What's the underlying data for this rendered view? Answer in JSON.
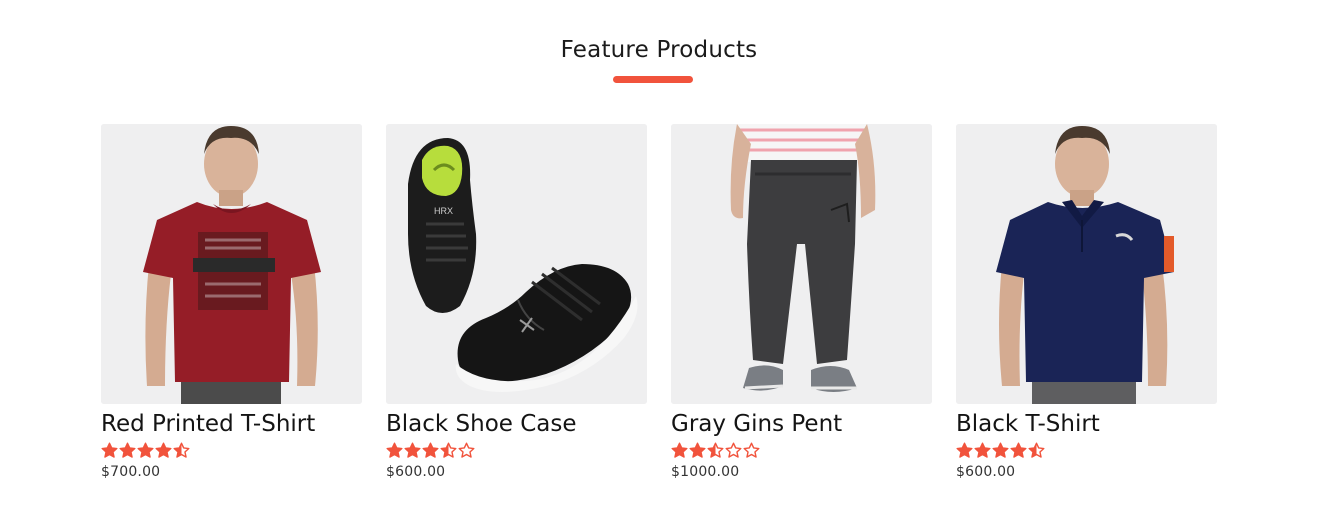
{
  "section": {
    "title": "Feature Products",
    "accent_color": "#f1533c"
  },
  "products": [
    {
      "name": "Red Printed T-Shirt",
      "price": "$700.00",
      "rating": 4.5,
      "image_icon": "red-tshirt-model-image"
    },
    {
      "name": "Black Shoe Case",
      "price": "$600.00",
      "rating": 3.5,
      "image_icon": "black-shoes-image"
    },
    {
      "name": "Gray Gins Pent",
      "price": "$1000.00",
      "rating": 2.5,
      "image_icon": "gray-pants-model-image"
    },
    {
      "name": "Black T-Shirt",
      "price": "$600.00",
      "rating": 4.5,
      "image_icon": "navy-polo-model-image"
    }
  ],
  "star_color": "#f1533c"
}
